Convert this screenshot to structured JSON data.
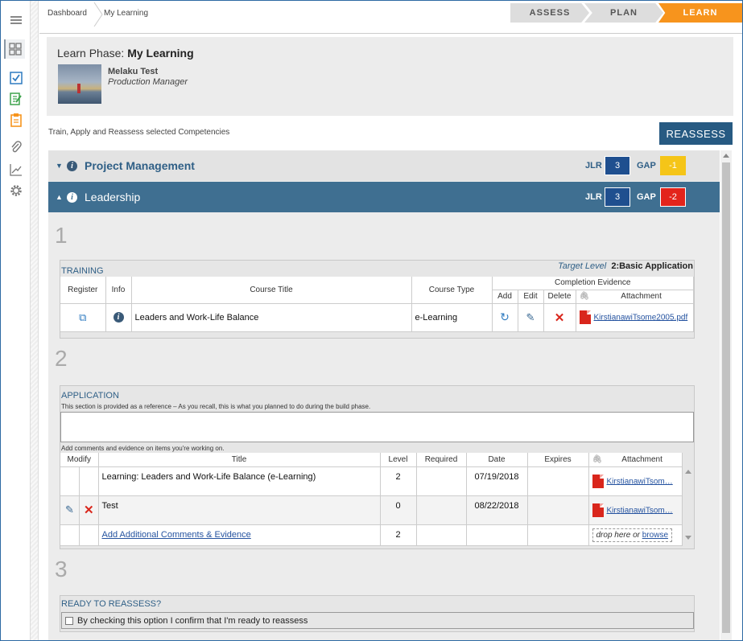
{
  "breadcrumb": {
    "home": "Dashboard",
    "current": "My Learning"
  },
  "steps": [
    {
      "label": "ASSESS"
    },
    {
      "label": "PLAN"
    },
    {
      "label": "LEARN"
    }
  ],
  "header": {
    "phase_prefix": "Learn Phase:",
    "phase_name": "My Learning",
    "user_name": "Melaku Test",
    "user_role": "Production Manager"
  },
  "instructions": "Train, Apply and Reassess selected Competencies",
  "reassess_button": "REASSESS",
  "competencies": [
    {
      "name": "Project Management",
      "jlr_label": "JLR",
      "jlr": "3",
      "gap_label": "GAP",
      "gap": "-1",
      "gap_color": "#f5c518",
      "expanded": false
    },
    {
      "name": "Leadership",
      "jlr_label": "JLR",
      "jlr": "3",
      "gap_label": "GAP",
      "gap": "-2",
      "gap_color": "#e3241b",
      "expanded": true
    }
  ],
  "section1": {
    "number": "1",
    "title": "TRAINING",
    "target_label": "Target Level",
    "target_value": "2:Basic Application",
    "headers": {
      "register": "Register",
      "info": "Info",
      "course_title": "Course Title",
      "course_type": "Course Type",
      "completion_evidence": "Completion Evidence",
      "add": "Add",
      "edit": "Edit",
      "delete": "Delete",
      "attachment": "Attachment"
    },
    "rows": [
      {
        "course_title": "Leaders and Work-Life Balance",
        "course_type": "e-Learning",
        "attachment": "KirstianawiTsome2005.pdf"
      }
    ]
  },
  "section2": {
    "number": "2",
    "title": "APPLICATION",
    "reference_note": "This section is provided as a reference – As you recall, this is what you planned to do during the build phase.",
    "comments_note": "Add comments and evidence on items you're working on.",
    "headers": {
      "modify": "Modify",
      "title": "Title",
      "level": "Level",
      "required": "Required",
      "date": "Date",
      "expires": "Expires",
      "attachment": "Attachment"
    },
    "rows": [
      {
        "title": "Learning: Leaders and Work-Life Balance (e-Learning)",
        "level": "2",
        "required": "",
        "date": "07/19/2018",
        "expires": "",
        "attachment": "KirstianawiTsom…"
      },
      {
        "title": "Test",
        "level": "0",
        "required": "",
        "date": "08/22/2018",
        "expires": "",
        "attachment": "KirstianawiTsom…"
      }
    ],
    "add_row": {
      "link": "Add Additional Comments & Evidence",
      "level": "2",
      "drop_text": "drop here or",
      "browse": "browse"
    }
  },
  "section3": {
    "number": "3",
    "title": "READY TO REASSESS?",
    "checkbox_label": "By checking this option I confirm that I'm ready to reassess"
  },
  "colors": {
    "primary": "#275a82",
    "accent": "#f7941d",
    "gap_red": "#e3241b",
    "gap_yellow": "#f5c518"
  }
}
